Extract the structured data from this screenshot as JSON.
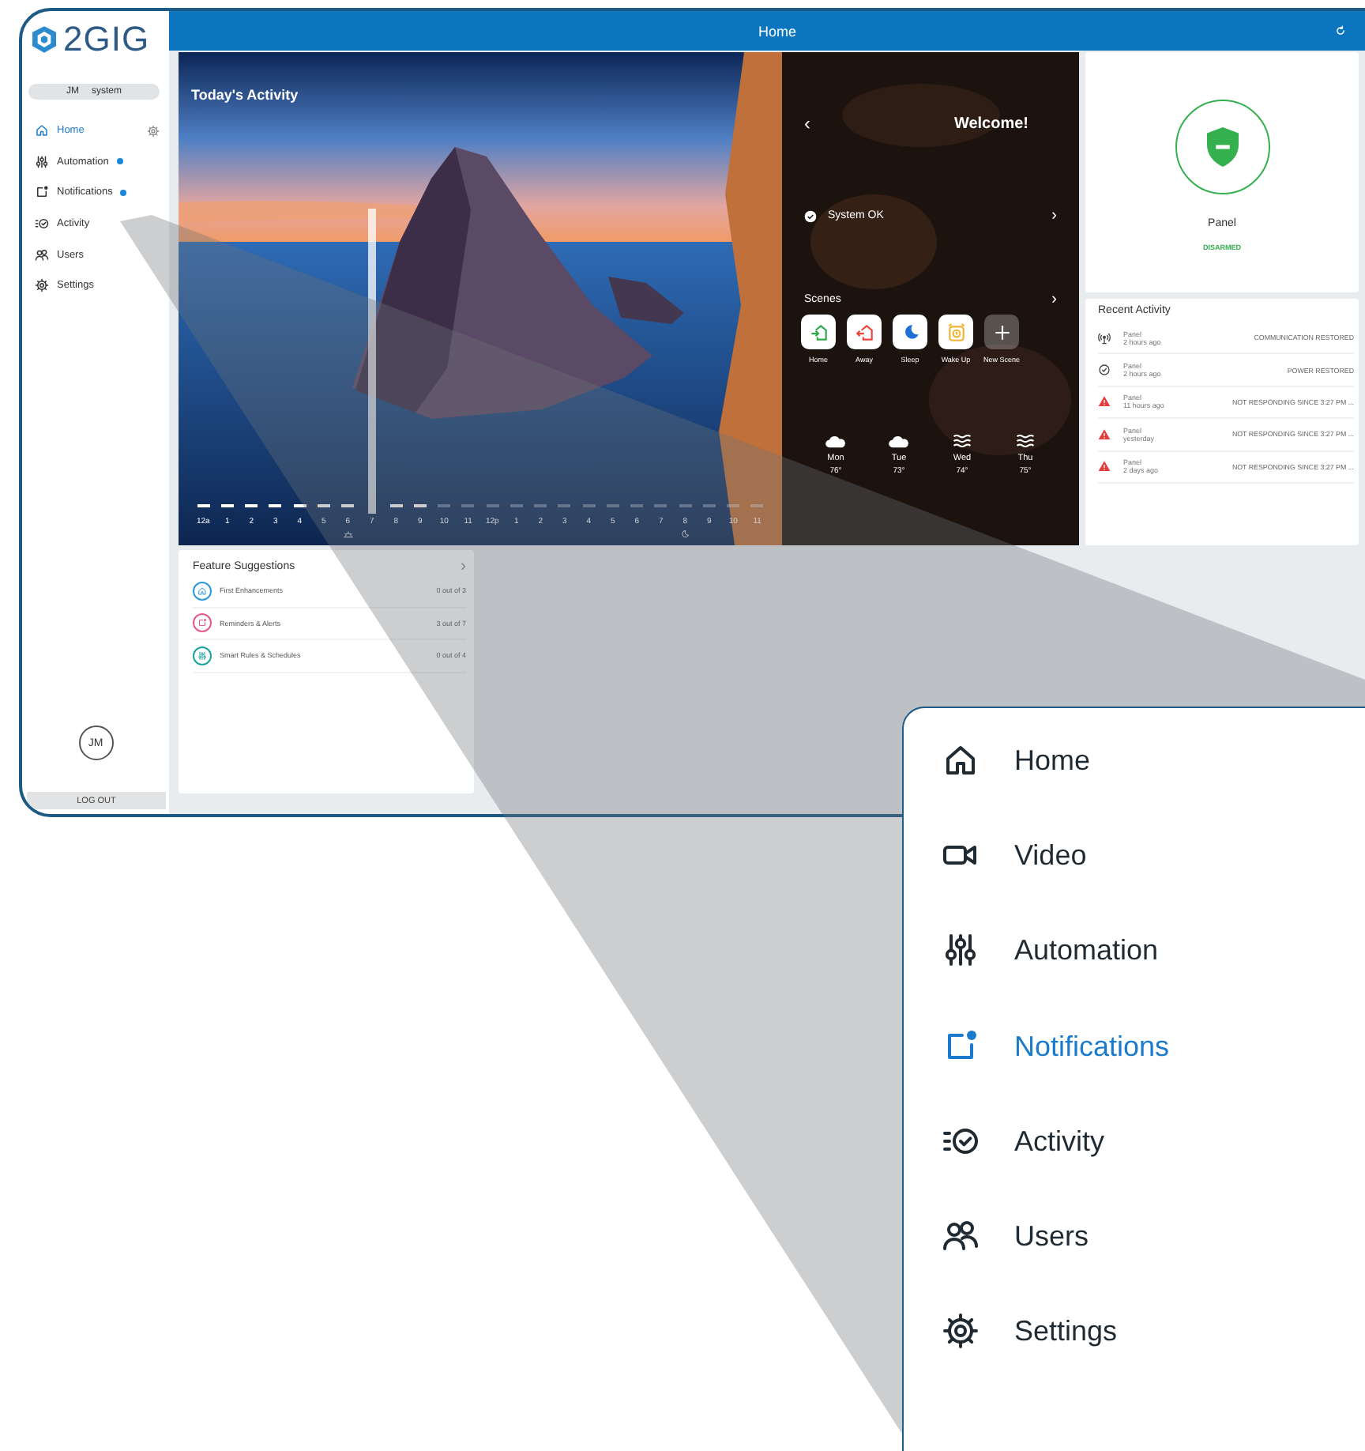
{
  "window": {
    "title": "Home"
  },
  "brand": {
    "logo_text": "2GIG"
  },
  "user": {
    "initials": "JM",
    "name": "system"
  },
  "sidebar": {
    "items": [
      {
        "label": "Home",
        "kind": "home",
        "selected": true,
        "badge": false,
        "gear": true
      },
      {
        "label": "Automation",
        "kind": "automation",
        "selected": false,
        "badge": true,
        "gear": false
      },
      {
        "label": "Notifications",
        "kind": "notifications",
        "selected": false,
        "badge": true,
        "gear": false
      },
      {
        "label": "Activity",
        "kind": "activity",
        "selected": false,
        "badge": false,
        "gear": false
      },
      {
        "label": "Users",
        "kind": "users",
        "selected": false,
        "badge": false,
        "gear": false
      },
      {
        "label": "Settings",
        "kind": "settings",
        "selected": false,
        "badge": false,
        "gear": false
      }
    ],
    "avatar": "JM",
    "logout": "LOG OUT"
  },
  "activity": {
    "title": "Today's Activity",
    "hours": [
      {
        "label": "12a",
        "lit": true,
        "current": false,
        "kind": "plain"
      },
      {
        "label": "1",
        "lit": true,
        "current": false,
        "kind": "plain"
      },
      {
        "label": "2",
        "lit": true,
        "current": false,
        "kind": "plain"
      },
      {
        "label": "3",
        "lit": true,
        "current": false,
        "kind": "plain"
      },
      {
        "label": "4",
        "lit": true,
        "current": false,
        "kind": "plain"
      },
      {
        "label": "5",
        "lit": true,
        "current": false,
        "kind": "plain"
      },
      {
        "label": "6",
        "lit": true,
        "current": false,
        "kind": "sunrise"
      },
      {
        "label": "7",
        "lit": true,
        "current": true,
        "kind": "plain"
      },
      {
        "label": "8",
        "lit": true,
        "current": false,
        "kind": "plain"
      },
      {
        "label": "9",
        "lit": true,
        "current": false,
        "kind": "plain"
      },
      {
        "label": "10",
        "lit": false,
        "current": false,
        "kind": "plain"
      },
      {
        "label": "11",
        "lit": false,
        "current": false,
        "kind": "plain"
      },
      {
        "label": "12p",
        "lit": false,
        "current": false,
        "kind": "plain"
      },
      {
        "label": "1",
        "lit": false,
        "current": false,
        "kind": "plain"
      },
      {
        "label": "2",
        "lit": false,
        "current": false,
        "kind": "plain"
      },
      {
        "label": "3",
        "lit": false,
        "current": false,
        "kind": "plain"
      },
      {
        "label": "4",
        "lit": false,
        "current": false,
        "kind": "plain"
      },
      {
        "label": "5",
        "lit": false,
        "current": false,
        "kind": "plain"
      },
      {
        "label": "6",
        "lit": false,
        "current": false,
        "kind": "plain"
      },
      {
        "label": "7",
        "lit": false,
        "current": false,
        "kind": "plain"
      },
      {
        "label": "8",
        "lit": false,
        "current": false,
        "kind": "sunset"
      },
      {
        "label": "9",
        "lit": false,
        "current": false,
        "kind": "plain"
      },
      {
        "label": "10",
        "lit": false,
        "current": false,
        "kind": "plain"
      },
      {
        "label": "11",
        "lit": false,
        "current": false,
        "kind": "plain"
      }
    ]
  },
  "welcome": {
    "back": "‹",
    "title": "Welcome!",
    "status": "System OK",
    "status_chevron": "›",
    "scenes_label": "Scenes",
    "scenes_chevron": "›",
    "scenes": [
      {
        "label": "Home",
        "kind": "home",
        "color": "#2eaa4a"
      },
      {
        "label": "Away",
        "kind": "away",
        "color": "#e8473c"
      },
      {
        "label": "Sleep",
        "kind": "sleep",
        "color": "#1f6fd6"
      },
      {
        "label": "Wake Up",
        "kind": "wake",
        "color": "#f2b233"
      },
      {
        "label": "New Scene",
        "kind": "add"
      }
    ],
    "weather": [
      {
        "day": "Mon",
        "temp": "76°",
        "kind": "cloud"
      },
      {
        "day": "Tue",
        "temp": "73°",
        "kind": "cloud"
      },
      {
        "day": "Wed",
        "temp": "74°",
        "kind": "fog"
      },
      {
        "day": "Thu",
        "temp": "75°",
        "kind": "fog"
      }
    ]
  },
  "panel": {
    "name": "Panel",
    "state": "DISARMED",
    "armed": false
  },
  "recent_activity": {
    "title": "Recent Activity",
    "rows": [
      {
        "kind": "signal",
        "device": "Panel",
        "time": "2 hours ago",
        "event": "COMMUNICATION RESTORED"
      },
      {
        "kind": "check",
        "device": "Panel",
        "time": "2 hours ago",
        "event": "POWER RESTORED"
      },
      {
        "kind": "alert",
        "device": "Panel",
        "time": "11 hours ago",
        "event": "NOT RESPONDING SINCE 3:27 PM ..."
      },
      {
        "kind": "alert",
        "device": "Panel",
        "time": "yesterday",
        "event": "NOT RESPONDING SINCE 3:27 PM ..."
      },
      {
        "kind": "alert",
        "device": "Panel",
        "time": "2 days ago",
        "event": "NOT RESPONDING SINCE 3:27 PM ..."
      }
    ]
  },
  "feature_suggestions": {
    "title": "Feature Suggestions",
    "chevron": "›",
    "items": [
      {
        "label": "First Enhancements",
        "progress": "0 out of 3",
        "kind": "home",
        "color": "#2a9be0"
      },
      {
        "label": "Reminders & Alerts",
        "progress": "3 out of 7",
        "kind": "notifications",
        "color": "#e8588a"
      },
      {
        "label": "Smart Rules & Schedules",
        "progress": "0 out of 4",
        "kind": "automation",
        "color": "#1aa59a"
      }
    ]
  },
  "callout": {
    "items": [
      {
        "label": "Home",
        "kind": "home",
        "selected": false
      },
      {
        "label": "Video",
        "kind": "video",
        "selected": false
      },
      {
        "label": "Automation",
        "kind": "automation",
        "selected": false
      },
      {
        "label": "Notifications",
        "kind": "notifications",
        "selected": true
      },
      {
        "label": "Activity",
        "kind": "activity",
        "selected": false
      },
      {
        "label": "Users",
        "kind": "users",
        "selected": false
      },
      {
        "label": "Settings",
        "kind": "settings",
        "selected": false
      }
    ]
  }
}
